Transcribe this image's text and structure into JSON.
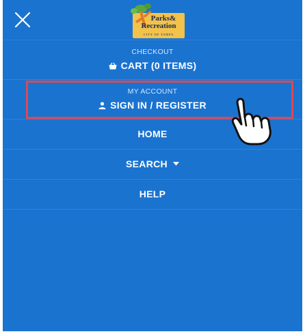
{
  "header": {
    "close_icon": "close-x-icon",
    "logo": {
      "line1": "Parks&",
      "line2": "Recreation",
      "line3": "CITY OF TAMPA"
    }
  },
  "menu": {
    "checkout": {
      "small_label": "CHECKOUT",
      "label": "CART (0 ITEMS)",
      "icon": "basket-icon"
    },
    "account": {
      "small_label": "MY ACCOUNT",
      "label": "SIGN IN / REGISTER",
      "icon": "user-icon"
    },
    "home": {
      "label": "HOME"
    },
    "search": {
      "label": "SEARCH",
      "icon": "caret-down-icon"
    },
    "help": {
      "label": "HELP"
    }
  },
  "colors": {
    "background": "#1b73d0",
    "highlight": "#e0484f",
    "text": "#ffffff"
  }
}
